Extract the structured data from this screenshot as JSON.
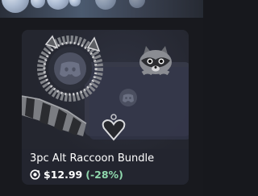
{
  "product": {
    "title": "3pc Alt Raccoon Bundle",
    "price": "$12.99",
    "discount": "(-28%)",
    "currency_icon": "orb-icon"
  },
  "colors": {
    "background": "#18191e",
    "card": "#23252f",
    "price_text": "#ffffff",
    "discount_text": "#8fd8ad"
  }
}
